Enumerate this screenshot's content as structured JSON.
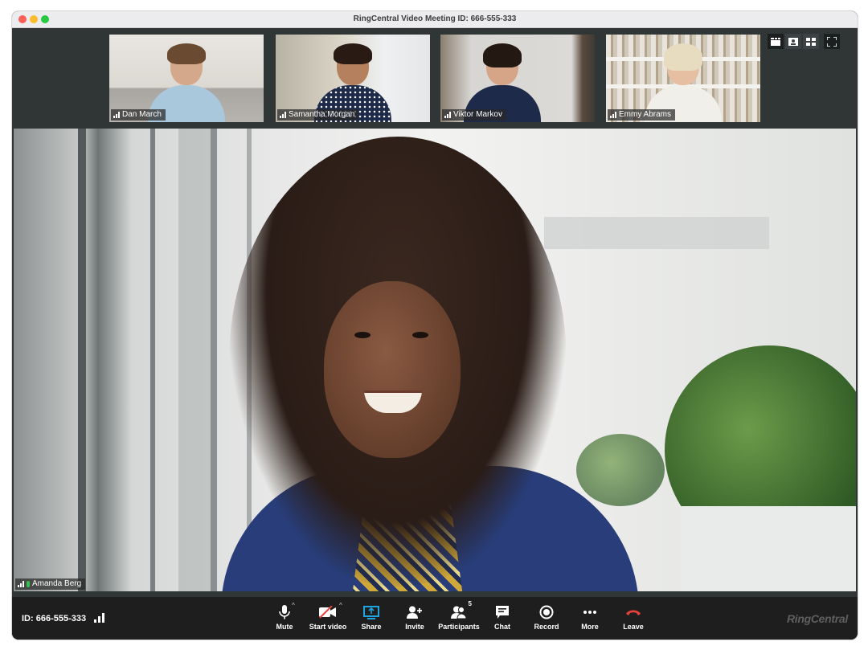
{
  "window": {
    "title": "RingCentral Video Meeting ID: 666-555-333"
  },
  "participants": [
    {
      "name": "Dan March",
      "signal": "signal-icon"
    },
    {
      "name": "Samantha Morgan",
      "signal": "signal-icon"
    },
    {
      "name": "Viktor Markov",
      "signal": "signal-icon"
    },
    {
      "name": "Emmy Abrams",
      "signal": "signal-icon"
    }
  ],
  "view_controls": {
    "buttons": [
      {
        "name": "gallery-strip-view-icon",
        "active": true
      },
      {
        "name": "speaker-view-icon",
        "active": false
      },
      {
        "name": "grid-view-icon",
        "active": false
      }
    ],
    "fullscreen": "fullscreen-icon"
  },
  "active_speaker": {
    "name": "Amanda Berg",
    "mic_status": "speaking"
  },
  "toolbar": {
    "meeting_id": "ID: 666-555-333",
    "buttons": [
      {
        "label": "Mute",
        "icon": "microphone-icon",
        "has_caret": true
      },
      {
        "label": "Start video",
        "icon": "video-off-icon",
        "has_caret": true
      },
      {
        "label": "Share",
        "icon": "share-screen-icon"
      },
      {
        "label": "Invite",
        "icon": "add-user-icon"
      },
      {
        "label": "Participants",
        "icon": "participants-icon",
        "badge": "5"
      },
      {
        "label": "Chat",
        "icon": "chat-icon"
      },
      {
        "label": "Record",
        "icon": "record-icon"
      },
      {
        "label": "More",
        "icon": "more-icon"
      },
      {
        "label": "Leave",
        "icon": "leave-phone-icon"
      }
    ],
    "brand": "RingCentral"
  },
  "colors": {
    "share_accent": "#1fa4e0",
    "leave_red": "#e8403a",
    "video_off_red": "#e8403a",
    "speaking_green": "#32c14a"
  }
}
